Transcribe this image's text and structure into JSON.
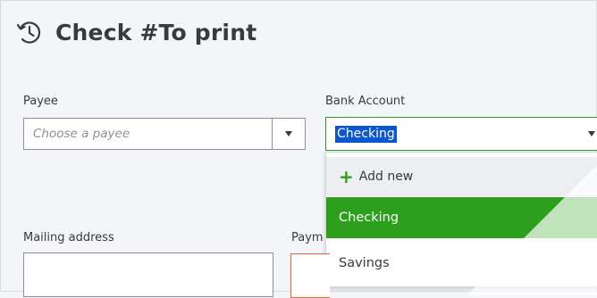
{
  "page": {
    "title": "Check #To print",
    "title_icon": "history-clock-icon"
  },
  "form": {
    "payee": {
      "label": "Payee",
      "placeholder": "Choose a payee",
      "arrow_icon": "chevron-down-icon"
    },
    "bank_account": {
      "label": "Bank Account",
      "value": "Checking",
      "arrow_icon": "chevron-down-icon"
    },
    "mailing_address": {
      "label": "Mailing address"
    },
    "payment_date": {
      "label": "Paym"
    }
  },
  "dropdown": {
    "add_new_label": "Add new",
    "add_new_icon": "plus-icon",
    "options": [
      "Checking",
      "Savings"
    ],
    "selected": "Checking"
  },
  "colors": {
    "accent_green": "#2ca01c",
    "selection_blue": "#0b57d0",
    "error_orange": "#e9623b",
    "text": "#393a3d"
  }
}
